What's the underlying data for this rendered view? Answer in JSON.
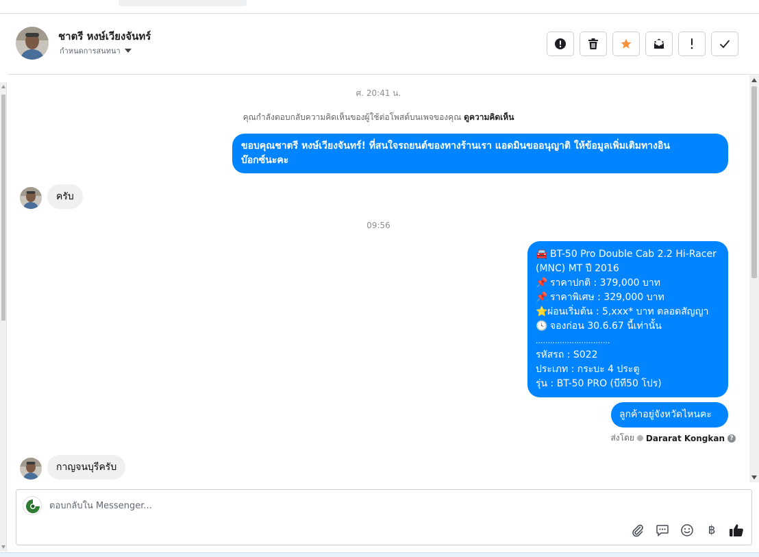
{
  "header": {
    "contact_name": "ชาตรี หงษ์เวียงจันทร์",
    "assign_label": "กำหนดการสนทนา",
    "buttons": [
      {
        "name": "report-button",
        "icon": "alert-circle-icon"
      },
      {
        "name": "delete-button",
        "icon": "trash-icon"
      },
      {
        "name": "star-button",
        "icon": "star-icon",
        "color": "#f5923e"
      },
      {
        "name": "mark-unread-button",
        "icon": "envelope-icon"
      },
      {
        "name": "important-button",
        "icon": "exclamation-icon"
      },
      {
        "name": "done-button",
        "icon": "check-icon"
      }
    ]
  },
  "chat": {
    "timestamp_1": "ศ. 20:41 น.",
    "notice_text": "คุณกำลังตอบกลับความคิดเห็นของผู้ใช้ต่อโพสต์บนเพจของคุณ",
    "notice_link": "ดูความคิดเห็น",
    "msg_out_1_line1": "ขอบคุณชาตรี หงษ์เวียงจันทร์! ที่สนใจรถยนต์ของทางร้านเรา แอดมินขออนุญาติ ให้ข้อมูลเพิ่มเติมทางอิน",
    "msg_out_1_line2": "บ๊อกซ์นะคะ",
    "msg_in_1": "ครับ",
    "timestamp_2": "09:56",
    "listing": {
      "lines": [
        {
          "emoji": "🚘",
          "text": "BT-50 Pro Double Cab 2.2 Hi-Racer"
        },
        {
          "emoji": "",
          "text": "(MNC) MT ปี 2016"
        },
        {
          "emoji": "📌",
          "text": "ราคาปกติ : 379,000 บาท"
        },
        {
          "emoji": "📌",
          "text": "ราคาพิเศษ : 329,000 บาท"
        },
        {
          "emoji": "⭐",
          "text": "ผ่อนเริ่มต้น : 5,xxx* บาท ตลอดสัญญา"
        },
        {
          "emoji": "🕓",
          "text": "จองก่อน 30.6.67 นี้เท่านั้น"
        },
        {
          "emoji": "",
          "text": "..............................."
        },
        {
          "emoji": "",
          "text": "รหัสรถ : S022"
        },
        {
          "emoji": "",
          "text": "ประเภท : กระบะ 4 ประตู"
        },
        {
          "emoji": "",
          "text": "รุ่น : BT-50 PRO (บีที50 โปร)"
        }
      ]
    },
    "msg_out_3": "ลูกค้าอยู่จังหวัดไหนคะ",
    "sent_by_label": "ส่งโดย",
    "sent_by_name": "Dararat Kongkan",
    "msg_in_2": "กาญจนบุรีครับ"
  },
  "composer": {
    "placeholder": "ตอบกลับใน Messenger...",
    "tools": [
      {
        "name": "attach-button",
        "icon": "paperclip-icon"
      },
      {
        "name": "saved-replies-button",
        "icon": "chat-bubble-icon"
      },
      {
        "name": "emoji-button",
        "icon": "smiley-icon"
      },
      {
        "name": "payment-button",
        "icon": "baht-icon",
        "glyph": "฿"
      },
      {
        "name": "like-button",
        "icon": "thumbs-up-icon"
      }
    ]
  },
  "colors": {
    "accent": "#0084ff",
    "incoming_bubble": "#f0f0f0",
    "star": "#f5923e"
  }
}
